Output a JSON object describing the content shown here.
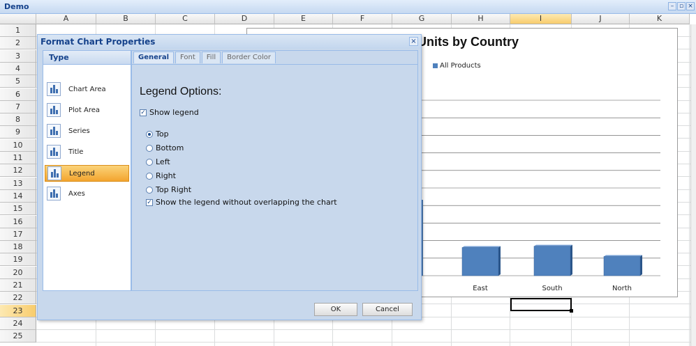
{
  "window": {
    "title": "Demo"
  },
  "columns": [
    "A",
    "B",
    "C",
    "D",
    "E",
    "F",
    "G",
    "H",
    "I",
    "J",
    "K"
  ],
  "rows": [
    "1",
    "2",
    "3",
    "4",
    "5",
    "6",
    "7",
    "8",
    "9",
    "10",
    "11",
    "12",
    "13",
    "14",
    "15",
    "16",
    "17",
    "18",
    "19",
    "20",
    "21",
    "22",
    "23",
    "24",
    "25"
  ],
  "selected_column": "I",
  "selected_row": "23",
  "chart": {
    "title": "Units by Country",
    "legend": "All Products",
    "colors": {
      "bar": "#4f81bd",
      "bar_side": "#2a5589"
    },
    "chart_data": {
      "type": "bar",
      "categories": [
        "East",
        "South",
        "North"
      ],
      "series": [
        {
          "name": "All Products",
          "values": [
            44,
            46,
            30
          ]
        }
      ],
      "title": "Units by Country",
      "legend_position": "top-left",
      "grid": true
    }
  },
  "dialog": {
    "title": "Format Chart Properties",
    "close_symbol": "×",
    "type_header": "Type",
    "types": [
      {
        "label": "Chart Area",
        "icon": "chart-area-icon"
      },
      {
        "label": "Plot Area",
        "icon": "plot-area-icon"
      },
      {
        "label": "Series",
        "icon": "series-icon"
      },
      {
        "label": "Title",
        "icon": "title-icon"
      },
      {
        "label": "Legend",
        "icon": "legend-icon"
      },
      {
        "label": "Axes",
        "icon": "axes-icon"
      }
    ],
    "active_type": "Legend",
    "tabs": [
      "General",
      "Font",
      "Fill",
      "Border Color"
    ],
    "active_tab": "General",
    "options_title": "Legend Options:",
    "show_legend": {
      "label": "Show legend",
      "checked": true
    },
    "positions": [
      {
        "label": "Top",
        "checked": true
      },
      {
        "label": "Bottom",
        "checked": false
      },
      {
        "label": "Left",
        "checked": false
      },
      {
        "label": "Right",
        "checked": false
      },
      {
        "label": "Top Right",
        "checked": false
      }
    ],
    "no_overlap": {
      "label": "Show the legend without overlapping the chart",
      "checked": true
    },
    "ok_label": "OK",
    "cancel_label": "Cancel"
  }
}
